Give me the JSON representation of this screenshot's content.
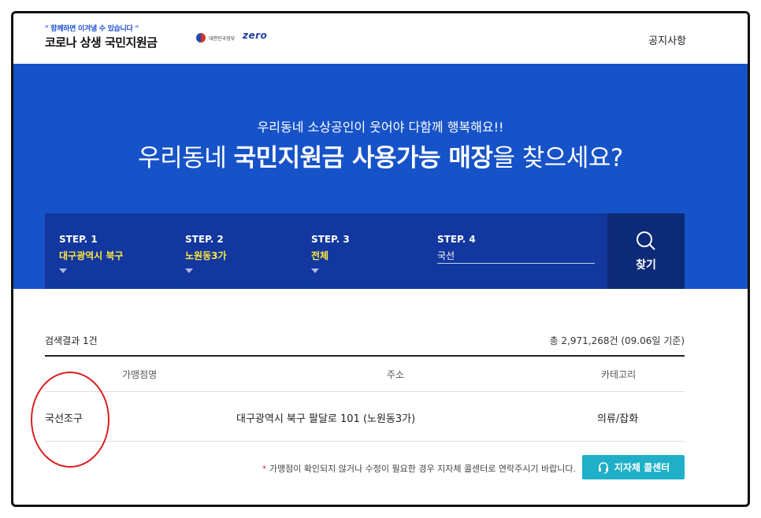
{
  "header": {
    "slogan": "\" 함께하면 이겨낼 수 있습니다 \"",
    "title": "코로나 상생 국민지원금",
    "gov_text": "대한민국정부",
    "zero_logo": "zero",
    "notice_link": "공지사항"
  },
  "hero": {
    "subtitle": "우리동네 소상공인이 웃어야 다함께 행복해요!!",
    "title_prefix": "우리동네 ",
    "title_bold": "국민지원금 사용가능 매장",
    "title_suffix": "을 찾으세요?"
  },
  "search": {
    "steps": [
      {
        "label": "STEP. 1",
        "value": "대구광역시 북구"
      },
      {
        "label": "STEP. 2",
        "value": "노원동3가"
      },
      {
        "label": "STEP. 3",
        "value": "전체"
      },
      {
        "label": "STEP. 4",
        "value": "국선"
      }
    ],
    "button_label": "찾기"
  },
  "results": {
    "count_text": "검색결과 1건",
    "total_text": "총 2,971,268건 (09.06일 기준)",
    "columns": [
      "가맹점명",
      "주소",
      "카테고리"
    ],
    "rows": [
      {
        "name": "국선조구",
        "address": "대구광역시 북구 팔달로 101 (노원동3가)",
        "category": "의류/잡화"
      }
    ],
    "footnote_star": "*",
    "footnote": " 가맹점이 확인되지 않거나 수정이 필요한 경우 지자체 콜센터로 연락주시기 바랍니다.",
    "call_button": "지자체 콜센터"
  },
  "colors": {
    "hero_bg": "#1753c8",
    "search_bg": "#12379e",
    "search_btn_bg": "#0d2a78",
    "step_value": "#ffe740",
    "call_btn": "#1fb0c8",
    "annotation": "#d92020"
  }
}
